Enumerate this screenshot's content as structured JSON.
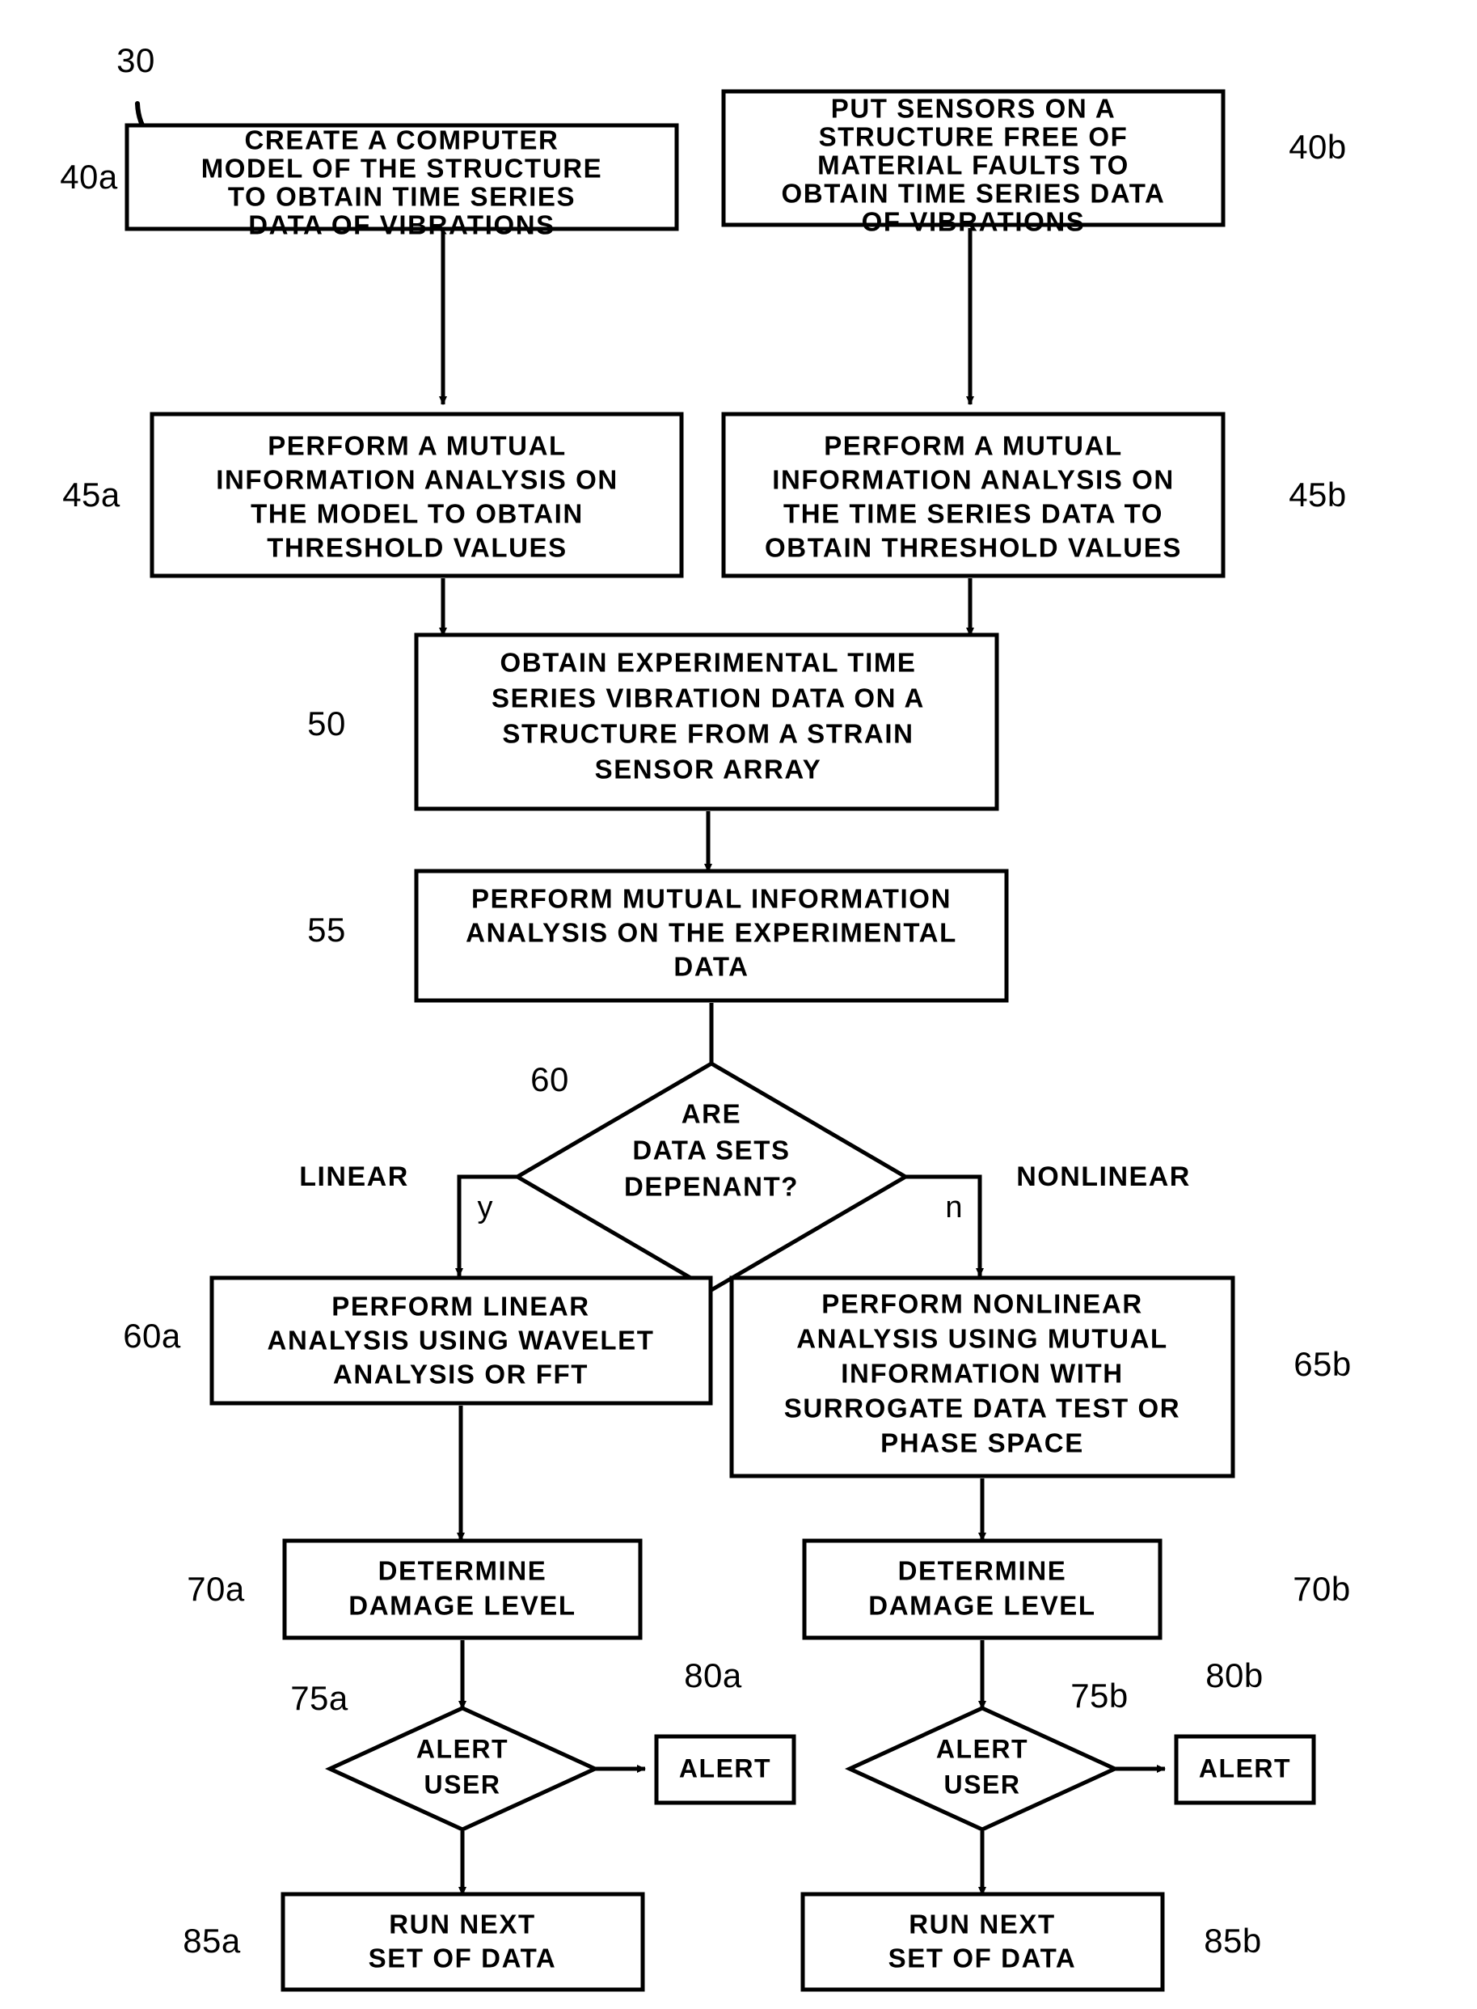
{
  "figure": {
    "figure_ref": "30",
    "boxes": [
      {
        "id": "40a",
        "ref": "40a",
        "lines": [
          "CREATE A COMPUTER",
          "MODEL OF THE STRUCTURE",
          "TO OBTAIN TIME SERIES",
          "DATA OF VIBRATIONS"
        ]
      },
      {
        "id": "40b",
        "ref": "40b",
        "lines": [
          "PUT SENSORS ON A",
          "STRUCTURE FREE OF",
          "MATERIAL FAULTS TO",
          "OBTAIN TIME SERIES DATA",
          "OF VIBRATIONS"
        ]
      },
      {
        "id": "45a",
        "ref": "45a",
        "lines": [
          "PERFORM A MUTUAL",
          "INFORMATION ANALYSIS ON",
          "THE MODEL TO OBTAIN",
          "THRESHOLD VALUES"
        ]
      },
      {
        "id": "45b",
        "ref": "45b",
        "lines": [
          "PERFORM A MUTUAL",
          "INFORMATION ANALYSIS ON",
          "THE TIME SERIES DATA TO",
          "OBTAIN THRESHOLD VALUES"
        ]
      },
      {
        "id": "50",
        "ref": "50",
        "lines": [
          "OBTAIN EXPERIMENTAL TIME",
          "SERIES VIBRATION DATA ON A",
          "STRUCTURE FROM A STRAIN",
          "SENSOR ARRAY"
        ]
      },
      {
        "id": "55",
        "ref": "55",
        "lines": [
          "PERFORM MUTUAL INFORMATION",
          "ANALYSIS ON THE EXPERIMENTAL",
          "DATA"
        ]
      },
      {
        "id": "60a",
        "ref": "60a",
        "lines": [
          "PERFORM LINEAR",
          "ANALYSIS USING WAVELET",
          "ANALYSIS OR FFT"
        ]
      },
      {
        "id": "65b",
        "ref": "65b",
        "lines": [
          "PERFORM NONLINEAR",
          "ANALYSIS USING MUTUAL",
          "INFORMATION WITH",
          "SURROGATE DATA TEST OR",
          "PHASE SPACE"
        ]
      },
      {
        "id": "70a",
        "ref": "70a",
        "lines": [
          "DETERMINE",
          "DAMAGE LEVEL"
        ]
      },
      {
        "id": "70b",
        "ref": "70b",
        "lines": [
          "DETERMINE",
          "DAMAGE LEVEL"
        ]
      },
      {
        "id": "80a",
        "ref": "80a",
        "lines": [
          "ALERT"
        ]
      },
      {
        "id": "80b",
        "ref": "80b",
        "lines": [
          "ALERT"
        ]
      },
      {
        "id": "85a",
        "ref": "85a",
        "lines": [
          "RUN NEXT",
          "SET OF DATA"
        ]
      },
      {
        "id": "85b",
        "ref": "85b",
        "lines": [
          "RUN NEXT",
          "SET OF DATA"
        ]
      }
    ],
    "decisions": [
      {
        "id": "60",
        "ref": "60",
        "lines": [
          "ARE",
          "DATA SETS",
          "DEPENANT?"
        ],
        "yes_label": "y",
        "no_label": "n",
        "yes_branch_label": "LINEAR",
        "no_branch_label": "NONLINEAR"
      },
      {
        "id": "75a",
        "ref": "75a",
        "lines": [
          "ALERT",
          "USER"
        ]
      },
      {
        "id": "75b",
        "ref": "75b",
        "lines": [
          "ALERT",
          "USER"
        ]
      }
    ],
    "colors": {
      "ink": "#000000",
      "paper": "#ffffff"
    }
  }
}
